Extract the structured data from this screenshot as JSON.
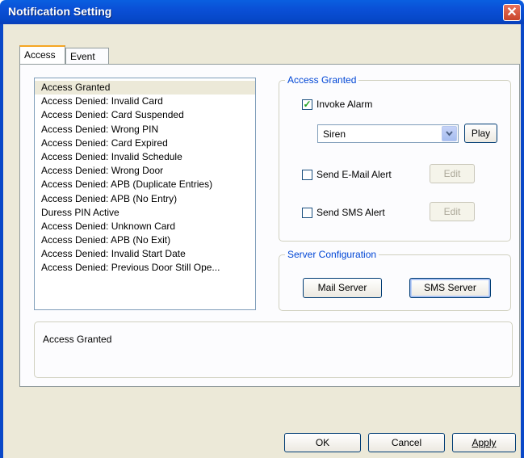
{
  "window": {
    "title": "Notification Setting"
  },
  "tabs": [
    {
      "label": "Access"
    },
    {
      "label": "Event"
    }
  ],
  "event_list": [
    "Access Granted",
    "Access Denied: Invalid Card",
    "Access Denied: Card Suspended",
    "Access Denied: Wrong PIN",
    "Access Denied: Card Expired",
    "Access Denied: Invalid Schedule",
    "Access Denied: Wrong Door",
    "Access Denied: APB (Duplicate Entries)",
    "Access Denied: APB (No Entry)",
    "Duress PIN Active",
    "Access Denied: Unknown Card",
    "Access Denied: APB (No Exit)",
    "Access Denied: Invalid Start Date",
    "Access Denied: Previous Door Still Ope..."
  ],
  "selected_event": "Access Granted",
  "access_group": {
    "title": "Access Granted",
    "invoke_alarm": {
      "label": "Invoke Alarm",
      "checked": true
    },
    "alarm_sound": {
      "value": "Siren"
    },
    "play_label": "Play",
    "email_alert": {
      "label": "Send E-Mail Alert",
      "checked": false,
      "edit_label": "Edit"
    },
    "sms_alert": {
      "label": "Send SMS Alert",
      "checked": false,
      "edit_label": "Edit"
    }
  },
  "server_group": {
    "title": "Server Configuration",
    "mail_server_label": "Mail Server",
    "sms_server_label": "SMS Server"
  },
  "description": "Access Granted",
  "footer": {
    "ok": "OK",
    "cancel": "Cancel",
    "apply": "Apply"
  }
}
